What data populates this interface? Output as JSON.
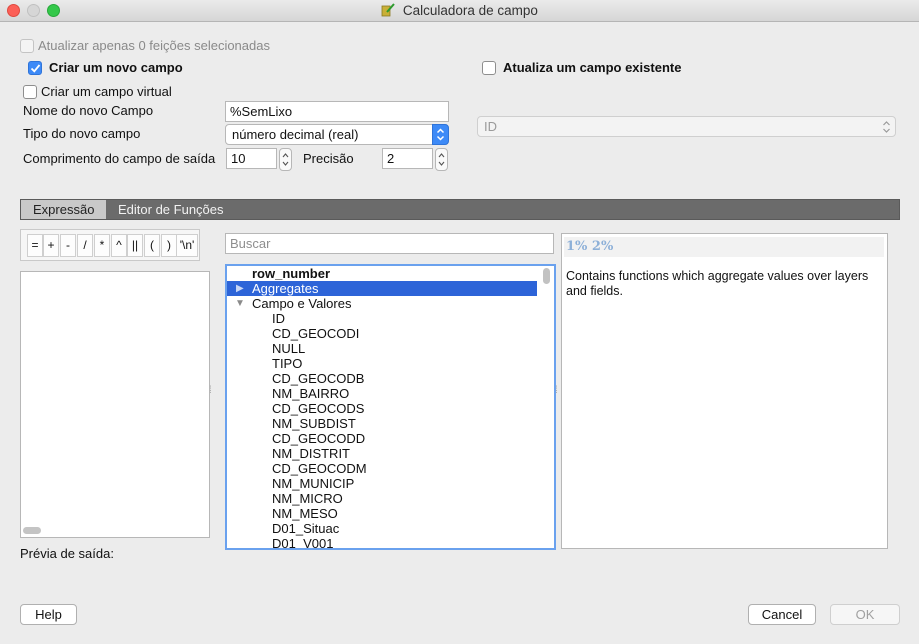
{
  "window": {
    "title": "Calculadora de campo"
  },
  "options": {
    "update_selected_label": "Atualizar apenas 0 feições selecionadas",
    "create_field_label": "Criar um novo campo",
    "update_existing_label": "Atualiza um campo existente",
    "virtual_field_label": "Criar um campo virtual"
  },
  "new_field": {
    "name_label": "Nome do novo Campo",
    "name_value": "%SemLixo",
    "type_label": "Tipo do novo campo",
    "type_value": "número decimal (real)",
    "length_label": "Comprimento do campo de saída",
    "length_value": "10",
    "precision_label": "Precisão",
    "precision_value": "2"
  },
  "existing_field": {
    "selected": "ID"
  },
  "tabs": [
    {
      "label": "Expressão"
    },
    {
      "label": "Editor de Funções"
    }
  ],
  "operators": [
    "=",
    "+",
    "-",
    "/",
    "*",
    "^",
    "||",
    "(",
    ")",
    "'\\n'"
  ],
  "search": {
    "placeholder": "Buscar"
  },
  "function_tree": {
    "items": [
      "row_number",
      "Aggregates",
      "Campo e Valores",
      "ID",
      "CD_GEOCODI",
      "NULL",
      "TIPO",
      "CD_GEOCODB",
      "NM_BAIRRO",
      "CD_GEOCODS",
      "NM_SUBDIST",
      "CD_GEOCODD",
      "NM_DISTRIT",
      "CD_GEOCODM",
      "NM_MUNICIP",
      "NM_MICRO",
      "NM_MESO",
      "D01_Situac",
      "D01_V001"
    ]
  },
  "help_panel": {
    "heading": "1% 2%",
    "text": "Contains functions which aggregate values over layers and fields."
  },
  "preview": {
    "label": "Prévia de saída:"
  },
  "buttons": {
    "help": "Help",
    "cancel": "Cancel",
    "ok": "OK"
  },
  "colors": {
    "accent": "#3d8af7",
    "selection": "#2d64d8",
    "tab_bar": "#6b6b6b"
  }
}
